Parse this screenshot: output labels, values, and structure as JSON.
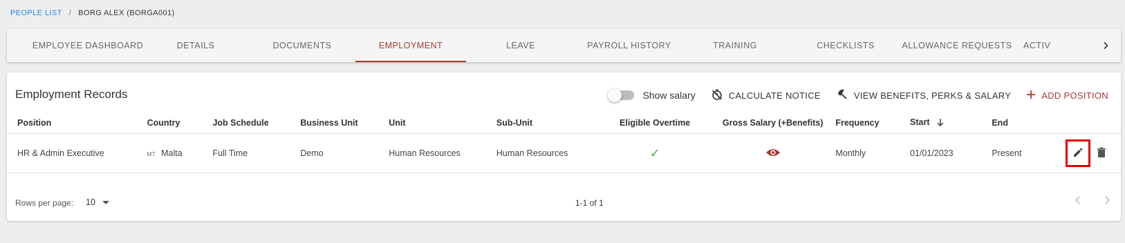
{
  "breadcrumb": {
    "link": "PEOPLE LIST",
    "separator": "/",
    "current": "BORG ALEX (BORGA001)"
  },
  "tabs": [
    {
      "label": "EMPLOYEE DASHBOARD"
    },
    {
      "label": "DETAILS"
    },
    {
      "label": "DOCUMENTS"
    },
    {
      "label": "EMPLOYMENT",
      "active": true
    },
    {
      "label": "LEAVE"
    },
    {
      "label": "PAYROLL HISTORY"
    },
    {
      "label": "TRAINING"
    },
    {
      "label": "CHECKLISTS"
    },
    {
      "label": "ALLOWANCE REQUESTS"
    },
    {
      "label": "ACTIV"
    }
  ],
  "card": {
    "title": "Employment Records",
    "show_salary_label": "Show salary",
    "show_salary_on": false,
    "calculate_notice_label": "CALCULATE NOTICE",
    "view_benefits_label": "VIEW BENEFITS, PERKS & SALARY",
    "add_position_label": "ADD POSITION"
  },
  "table": {
    "headers": [
      "Position",
      "Country",
      "Job Schedule",
      "Business Unit",
      "Unit",
      "Sub-Unit",
      "Eligible Overtime",
      "Gross Salary (+Benefits)",
      "Frequency",
      "Start",
      "End"
    ],
    "rows": [
      {
        "position": "HR & Admin Executive",
        "country_code": "MT",
        "country": "Malta",
        "job_schedule": "Full Time",
        "business_unit": "Demo",
        "unit": "Human Resources",
        "sub_unit": "Human Resources",
        "eligible_overtime": true,
        "frequency": "Monthly",
        "start": "01/01/2023",
        "end": "Present"
      }
    ]
  },
  "footer": {
    "rows_per_page_label": "Rows per page:",
    "rows_per_page_value": "10",
    "range_text": "1-1 of 1"
  },
  "colors": {
    "accent": "#a33a2f",
    "link": "#1e88e5",
    "check": "#4caf50",
    "highlight": "#e00000"
  }
}
